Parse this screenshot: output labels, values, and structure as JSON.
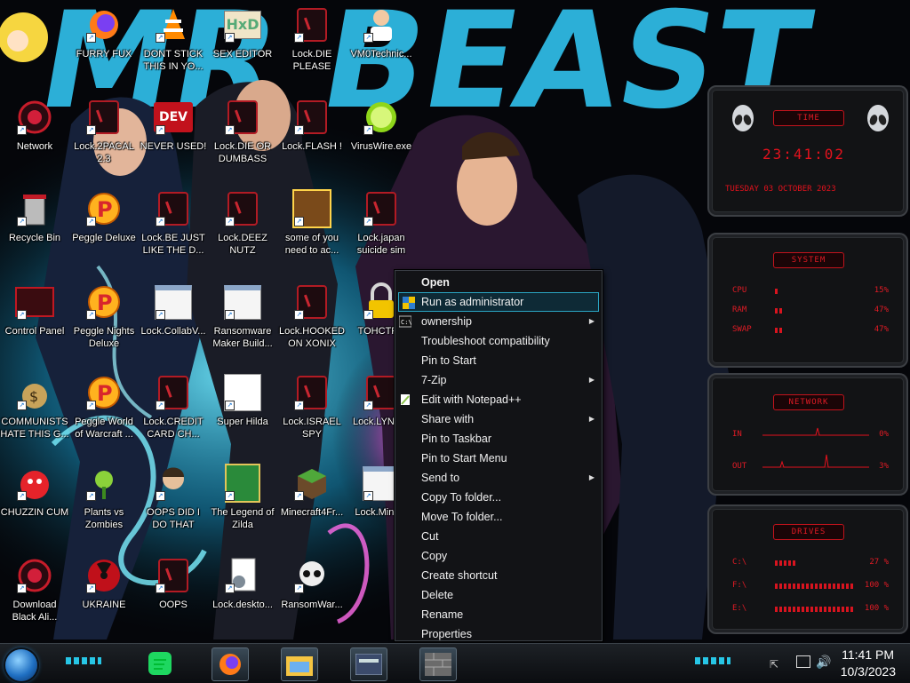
{
  "desktop": {
    "icons": [
      {
        "label": "FURRY FUX",
        "icon": "firefox-icon"
      },
      {
        "label": "DONT STICK THIS IN YO...",
        "icon": "vlc-cone-icon"
      },
      {
        "label": "SEX EDITOR",
        "icon": "hxd-editor-icon"
      },
      {
        "label": "Lock.DIE PLEASE",
        "icon": "lock-app-icon"
      },
      {
        "label": "VM0Technic...",
        "icon": "doctor-icon"
      },
      {
        "label": "Network",
        "icon": "network-orb-icon"
      },
      {
        "label": "Lock.2PACAL 2.3",
        "icon": "lock-app-icon"
      },
      {
        "label": "NEVER USED!",
        "icon": "dev-badge-icon"
      },
      {
        "label": "Lock.DIE OR DUMBASS",
        "icon": "lock-app-icon"
      },
      {
        "label": "Lock.FLASH !",
        "icon": "lock-app-icon"
      },
      {
        "label": "VirusWire.exe",
        "icon": "lime-icon"
      },
      {
        "label": "Recycle Bin",
        "icon": "recycle-bin-icon"
      },
      {
        "label": "Peggle Deluxe",
        "icon": "peggle-icon"
      },
      {
        "label": "Lock.BE JUST LIKE THE D...",
        "icon": "lock-app-icon"
      },
      {
        "label": "Lock.DEEZ NUTZ",
        "icon": "lock-app-icon"
      },
      {
        "label": "some of you need to ac...",
        "icon": "pixel-dog-icon"
      },
      {
        "label": "Lock.japan suicide sim",
        "icon": "lock-app-icon"
      },
      {
        "label": "Control Panel",
        "icon": "control-panel-icon"
      },
      {
        "label": "Peggle Nights Deluxe",
        "icon": "peggle-icon"
      },
      {
        "label": "Lock.CollabV...",
        "icon": "window-icon"
      },
      {
        "label": "Ransomware Maker Build...",
        "icon": "window-icon"
      },
      {
        "label": "Lock.HOOKED ON XONIX",
        "icon": "lock-app-icon"
      },
      {
        "label": "TOHCTP...",
        "icon": "padlock-icon"
      },
      {
        "label": "COMMUNISTS HATE THIS G...",
        "icon": "money-bag-icon"
      },
      {
        "label": "Peggle World of Warcraft ...",
        "icon": "peggle-icon"
      },
      {
        "label": "Lock.CREDIT CARD CH...",
        "icon": "lock-app-icon"
      },
      {
        "label": "Super Hilda",
        "icon": "pixel-ghost-icon"
      },
      {
        "label": "Lock.ISRAEL SPY",
        "icon": "lock-app-icon"
      },
      {
        "label": "Lock.LYNC...",
        "icon": "lock-app-icon"
      },
      {
        "label": "CHUZZIN CUM",
        "icon": "chuzzle-icon"
      },
      {
        "label": "Plants vs Zombies",
        "icon": "plant-icon"
      },
      {
        "label": "OOPS DID I DO THAT",
        "icon": "portrait-icon"
      },
      {
        "label": "The Legend of Zilda",
        "icon": "pixel-hero-icon"
      },
      {
        "label": "Minecraft4Fr...",
        "icon": "minecraft-block-icon"
      },
      {
        "label": "Lock.Mine...",
        "icon": "window-icon"
      },
      {
        "label": "Download Black Ali...",
        "icon": "network-orb-icon"
      },
      {
        "label": "UKRAINE",
        "icon": "radiation-icon"
      },
      {
        "label": "OOPS",
        "icon": "lock-app-icon"
      },
      {
        "label": "Lock.deskto...",
        "icon": "settings-file-icon"
      },
      {
        "label": "RansomWar...",
        "icon": "skull-icon"
      }
    ]
  },
  "context_menu": {
    "items": [
      {
        "label": "Open",
        "bold": true,
        "submenu": false,
        "icon": ""
      },
      {
        "label": "Run as administrator",
        "bold": false,
        "submenu": false,
        "icon": "shield-icon",
        "highlighted": true
      },
      {
        "label": "ownership",
        "bold": false,
        "submenu": true,
        "icon": "cmd-icon"
      },
      {
        "label": "Troubleshoot compatibility",
        "bold": false,
        "submenu": false,
        "icon": ""
      },
      {
        "label": "Pin to Start",
        "bold": false,
        "submenu": false,
        "icon": ""
      },
      {
        "label": "7-Zip",
        "bold": false,
        "submenu": true,
        "icon": ""
      },
      {
        "label": "Edit with Notepad++",
        "bold": false,
        "submenu": false,
        "icon": "notepadpp-icon"
      },
      {
        "label": "Share with",
        "bold": false,
        "submenu": true,
        "icon": ""
      },
      {
        "label": "Pin to Taskbar",
        "bold": false,
        "submenu": false,
        "icon": ""
      },
      {
        "label": "Pin to Start Menu",
        "bold": false,
        "submenu": false,
        "icon": ""
      },
      {
        "label": "Send to",
        "bold": false,
        "submenu": true,
        "icon": ""
      },
      {
        "label": "Copy To folder...",
        "bold": false,
        "submenu": false,
        "icon": ""
      },
      {
        "label": "Move To folder...",
        "bold": false,
        "submenu": false,
        "icon": ""
      },
      {
        "label": "Cut",
        "bold": false,
        "submenu": false,
        "icon": ""
      },
      {
        "label": "Copy",
        "bold": false,
        "submenu": false,
        "icon": ""
      },
      {
        "label": "Create shortcut",
        "bold": false,
        "submenu": false,
        "icon": ""
      },
      {
        "label": "Delete",
        "bold": false,
        "submenu": false,
        "icon": ""
      },
      {
        "label": "Rename",
        "bold": false,
        "submenu": false,
        "icon": ""
      },
      {
        "label": "Properties",
        "bold": false,
        "submenu": false,
        "icon": ""
      }
    ]
  },
  "gadgets": {
    "time": {
      "title": "TIME",
      "clock": "23:41:02",
      "date": "TUESDAY 03 OCTOBER 2023"
    },
    "system": {
      "title": "SYSTEM",
      "rows": [
        {
          "label": "CPU",
          "value": "15%",
          "level": 15
        },
        {
          "label": "RAM",
          "value": "47%",
          "level": 47
        },
        {
          "label": "SWAP",
          "value": "47%",
          "level": 47
        }
      ]
    },
    "network": {
      "title": "NETWORK",
      "rows": [
        {
          "label": "IN",
          "value": "0%"
        },
        {
          "label": "OUT",
          "value": "3%"
        }
      ]
    },
    "drives": {
      "title": "DRIVES",
      "rows": [
        {
          "label": "C:\\",
          "value": "27 %",
          "level": 27
        },
        {
          "label": "F:\\",
          "value": "100 %",
          "level": 100
        },
        {
          "label": "E:\\",
          "value": "100 %",
          "level": 100
        }
      ]
    }
  },
  "wallpaper": {
    "text": "MR BEAST"
  },
  "taskbar": {
    "apps": [
      {
        "icon": "spotify-like-icon"
      },
      {
        "icon": "firefox-icon"
      },
      {
        "icon": "file-explorer-icon"
      },
      {
        "icon": "control-card-icon"
      },
      {
        "icon": "brick-wall-icon"
      }
    ],
    "clock": {
      "time": "11:41 PM",
      "date": "10/3/2023"
    }
  },
  "colors": {
    "accent_cyan": "#27c6e6",
    "gadget_red": "#e3121d",
    "menu_bg": "#121316",
    "highlight_border": "#2aa6c4"
  }
}
